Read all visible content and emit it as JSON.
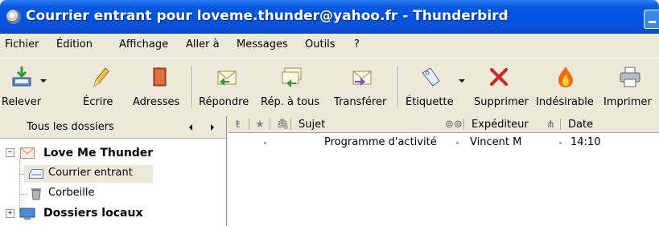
{
  "window": {
    "title": "Courrier entrant pour loveme.thunder@yahoo.fr - Thunderbird"
  },
  "menu": [
    {
      "label": "Fichier"
    },
    {
      "label": "Édition"
    },
    {
      "label": "Affichage"
    },
    {
      "label": "Aller à"
    },
    {
      "label": "Messages"
    },
    {
      "label": "Outils"
    },
    {
      "label": "?"
    }
  ],
  "toolbar": {
    "get_mail": "Relever",
    "write": "Écrire",
    "address_book": "Adresses",
    "reply": "Répondre",
    "reply_all": "Rép. à tous",
    "forward": "Transférer",
    "tag": "Étiquette",
    "delete": "Supprimer",
    "junk": "Indésirable",
    "print": "Imprimer"
  },
  "folder_pane": {
    "header": "Tous les dossiers",
    "accounts": [
      {
        "name": "Love Me Thunder",
        "expanded": true,
        "icon": "mail-account-icon",
        "folders": [
          {
            "name": "Courrier entrant",
            "icon": "inbox-icon",
            "selected": true
          },
          {
            "name": "Corbeille",
            "icon": "trash-icon",
            "selected": false
          }
        ]
      },
      {
        "name": "Dossiers locaux",
        "expanded": false,
        "icon": "local-folders-icon",
        "folders": []
      }
    ]
  },
  "thread_pane": {
    "columns": {
      "subject": "Sujet",
      "sender": "Expéditeur",
      "date": "Date"
    },
    "messages": [
      {
        "subject": "Programme d'activité",
        "sender": "Vincent M",
        "date": "14:10"
      }
    ]
  },
  "colors": {
    "titlebar": "#0054e3",
    "selection": "#ece9d8",
    "window_bg": "#ece9d8"
  }
}
